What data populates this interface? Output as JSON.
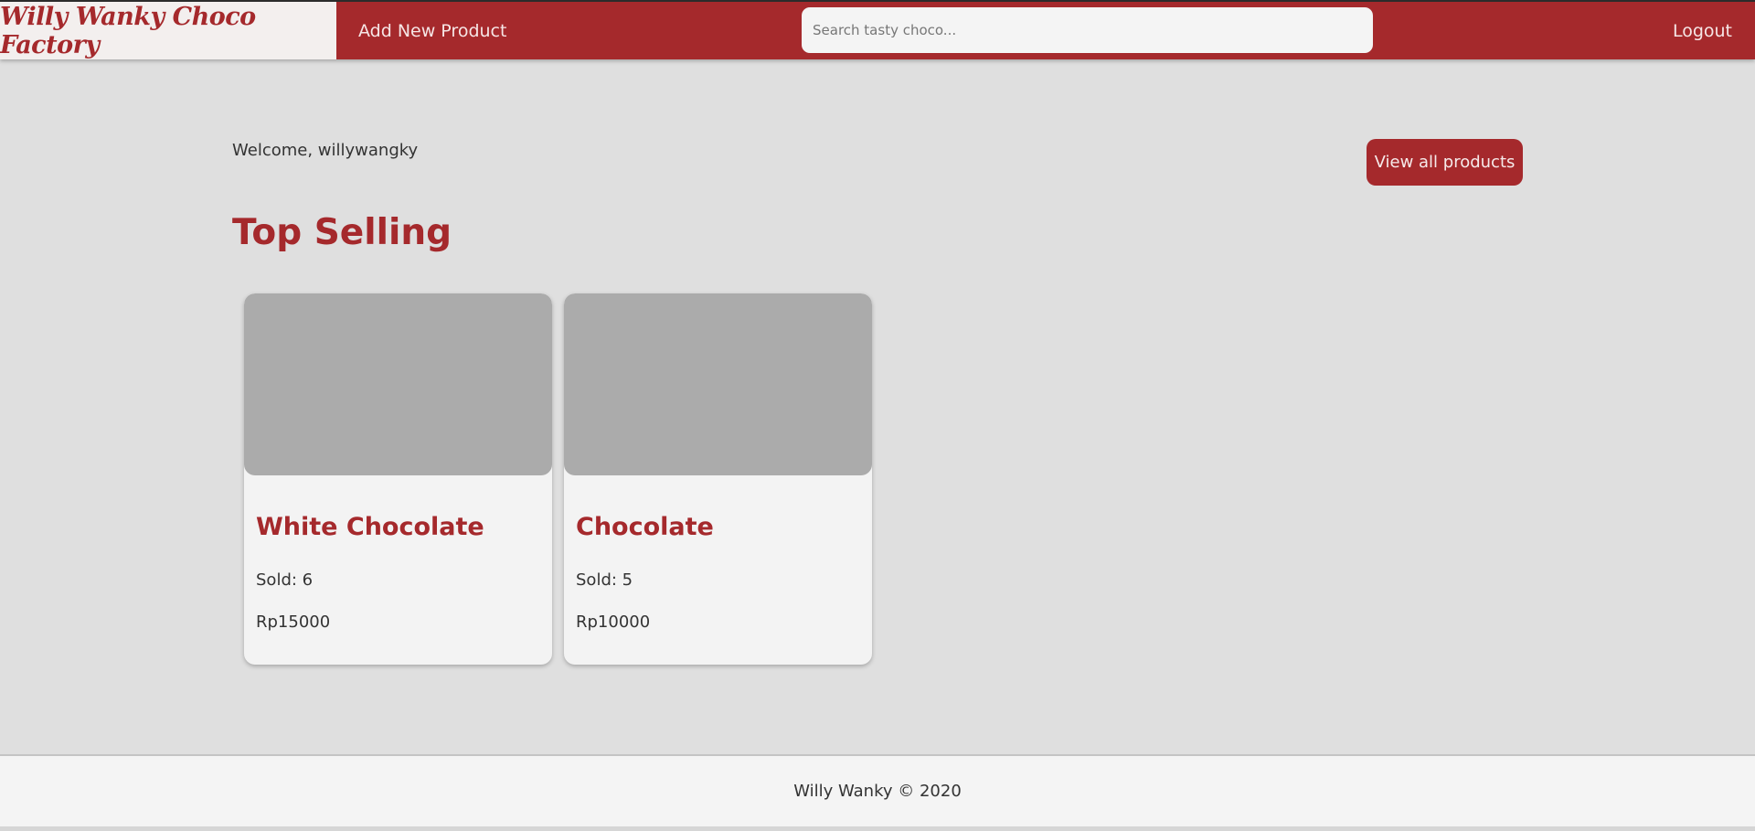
{
  "navbar": {
    "brand": "Willy Wanky Choco Factory",
    "add_product_label": "Add New Product",
    "search_placeholder": "Search tasty choco...",
    "logout_label": "Logout"
  },
  "main": {
    "welcome": "Welcome, willywangky",
    "view_all_label": "View all products",
    "section_title": "Top Selling",
    "products": [
      {
        "name": "White Chocolate",
        "sold": "Sold: 6",
        "price": "Rp15000"
      },
      {
        "name": "Chocolate",
        "sold": "Sold: 5",
        "price": "Rp10000"
      }
    ]
  },
  "footer": {
    "text": "Willy Wanky © 2020"
  },
  "colors": {
    "brand": "#a5292c",
    "background": "#dfdfdf",
    "card": "#f3f3f3",
    "image_placeholder": "#ababab"
  }
}
